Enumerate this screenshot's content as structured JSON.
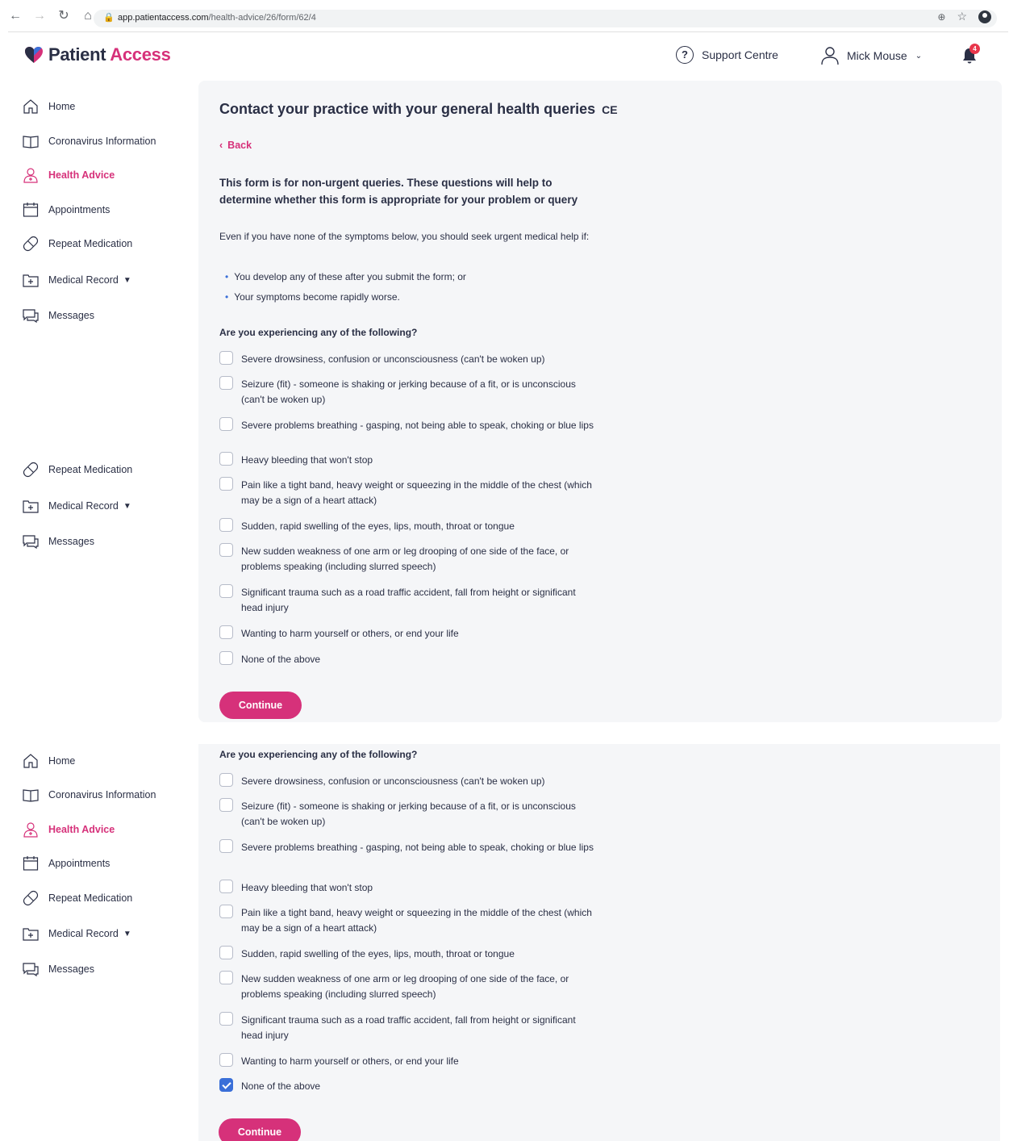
{
  "browser": {
    "url_host": "app.patientaccess.com",
    "url_path": "/health-advice/26/form/62/4"
  },
  "header": {
    "logo_part1": "Patient",
    "logo_part2": "Access",
    "support_label": "Support Centre",
    "user_name": "Mick Mouse",
    "notification_count": "4"
  },
  "sidebar": {
    "home": "Home",
    "coronavirus": "Coronavirus Information",
    "health_advice": "Health Advice",
    "appointments": "Appointments",
    "repeat_medication": "Repeat Medication",
    "medical_record": "Medical Record",
    "messages": "Messages"
  },
  "main": {
    "title": "Contact your practice with your general health queries",
    "ce_mark": "CE",
    "back_label": "Back",
    "intro": "This form is for non-urgent queries. These questions will help to determine whether this form is appropriate for your problem or query",
    "paragraph": "Even if you have none of the symptoms below, you should seek urgent medical help if:",
    "bullets": [
      "You develop any of these after you submit the form; or",
      "Your symptoms become rapidly worse."
    ],
    "question": "Are you experiencing any of the following?",
    "options": [
      "Severe drowsiness, confusion or unconsciousness (can't be woken up)",
      "Seizure (fit) - someone is shaking or jerking because of a fit, or is unconscious (can't be woken up)",
      "Severe problems breathing - gasping, not being able to speak, choking or blue lips",
      "Heavy bleeding that won't stop",
      "Pain like a tight band, heavy weight or squeezing in the middle of the chest (which may be a sign of a heart attack)",
      "Sudden, rapid swelling of the eyes, lips, mouth, throat or tongue",
      "New sudden weakness of one arm or leg drooping of one side of the face, or problems speaking (including slurred speech)",
      "Significant trauma such as a road traffic accident, fall from height or significant head injury",
      "Wanting to harm yourself or others, or end your life",
      "None of the above"
    ],
    "continue_label": "Continue"
  },
  "second_view": {
    "none_of_above_checked": true
  }
}
